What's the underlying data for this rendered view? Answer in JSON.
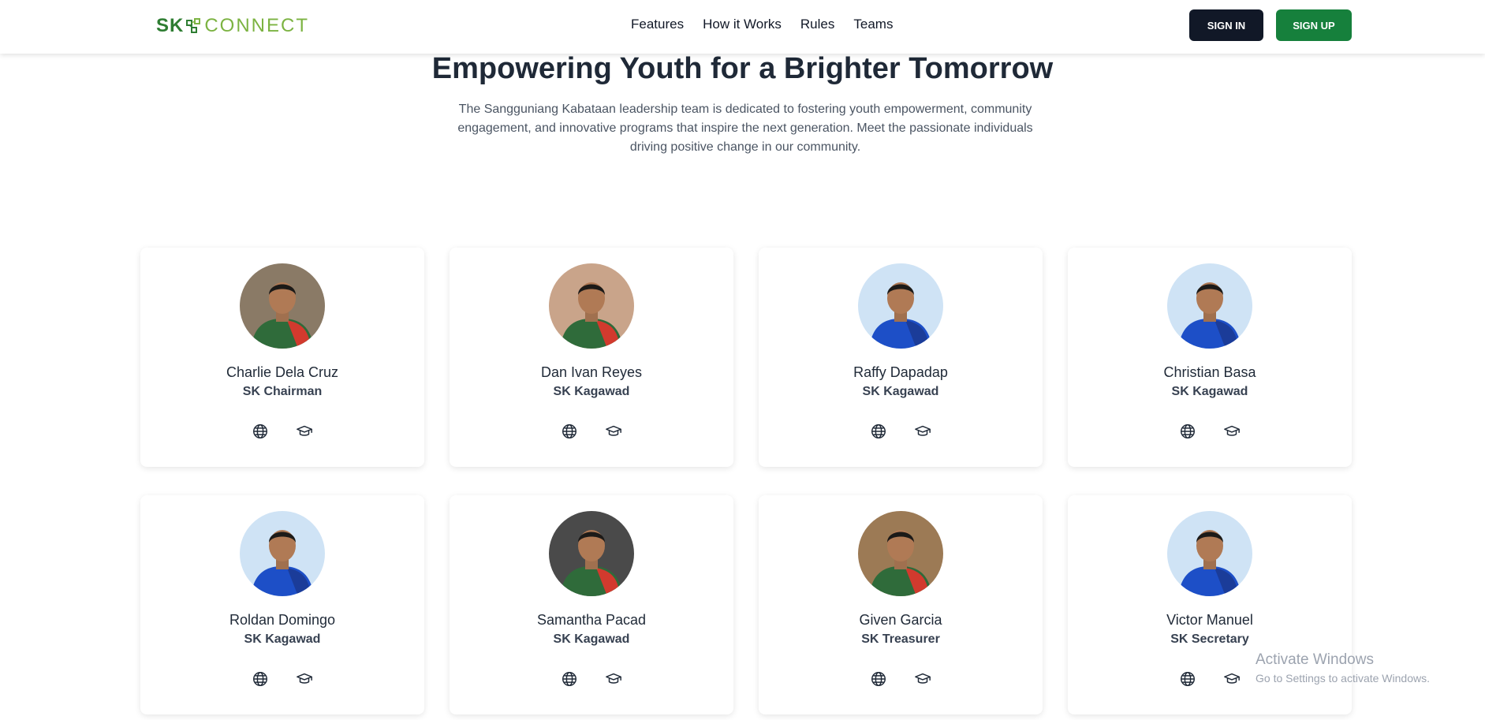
{
  "brand": {
    "sk": "SK",
    "connect": "CONNECT"
  },
  "nav": {
    "items": [
      "Features",
      "How it Works",
      "Rules",
      "Teams"
    ]
  },
  "auth": {
    "signin": "SIGN IN",
    "signup": "SIGN UP"
  },
  "hero": {
    "title": "Empowering Youth for a Brighter Tomorrow",
    "description": "The Sangguniang Kabataan leadership team is dedicated to fostering youth empowerment, community engagement, and innovative programs that inspire the next generation. Meet the passionate individuals driving positive change in our community."
  },
  "members": [
    {
      "name": "Charlie Dela Cruz",
      "role": "SK Chairman",
      "shirt": "#2f6b3a",
      "accent": "#d23a2e",
      "bg": "#8a7a66"
    },
    {
      "name": "Dan Ivan Reyes",
      "role": "SK Kagawad",
      "shirt": "#2f6b3a",
      "accent": "#d23a2e",
      "bg": "#c9a48a"
    },
    {
      "name": "Raffy Dapadap",
      "role": "SK Kagawad",
      "shirt": "#1d4fc7",
      "accent": "#1b3c99",
      "bg": "#cfe3f5"
    },
    {
      "name": "Christian Basa",
      "role": "SK Kagawad",
      "shirt": "#1d4fc7",
      "accent": "#1b3c99",
      "bg": "#cfe3f5"
    },
    {
      "name": "Roldan Domingo",
      "role": "SK Kagawad",
      "shirt": "#1d4fc7",
      "accent": "#1b3c99",
      "bg": "#cfe3f5"
    },
    {
      "name": "Samantha Pacad",
      "role": "SK Kagawad",
      "shirt": "#2f6b3a",
      "accent": "#d23a2e",
      "bg": "#4a4a4a"
    },
    {
      "name": "Given Garcia",
      "role": "SK Treasurer",
      "shirt": "#2f6b3a",
      "accent": "#d23a2e",
      "bg": "#9c7a55"
    },
    {
      "name": "Victor Manuel",
      "role": "SK Secretary",
      "shirt": "#1d4fc7",
      "accent": "#1b3c99",
      "bg": "#cfe3f5"
    }
  ],
  "watermark": {
    "line1": "Activate Windows",
    "line2": "Go to Settings to activate Windows."
  }
}
